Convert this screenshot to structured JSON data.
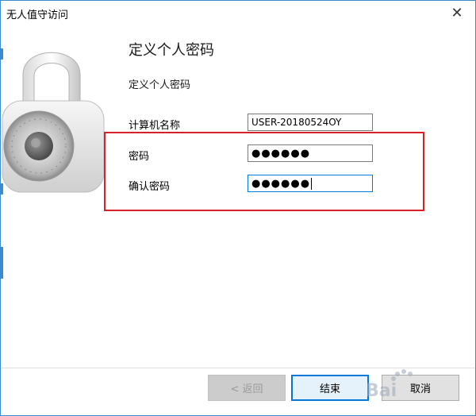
{
  "window": {
    "title": "无人值守访问",
    "close_glyph": "✕"
  },
  "header": {
    "title": "定义个人密码",
    "description": "定义个人密码"
  },
  "form": {
    "computer_name_label": "计算机名称",
    "computer_name_value": "USER-20180524OY",
    "password_label": "密码",
    "password_value": "●●●●●●",
    "confirm_label": "确认密码",
    "confirm_value": "●●●●●●"
  },
  "buttons": {
    "back": "< 返回",
    "finish": "结束",
    "cancel": "取消"
  },
  "watermark": {
    "text": "Bai"
  },
  "colors": {
    "accent": "#0078d7",
    "highlight": "#d6202a",
    "titlebar_border": "#3c8ad0"
  },
  "icons": {
    "lock": "combination-padlock-icon",
    "close": "close-icon"
  }
}
